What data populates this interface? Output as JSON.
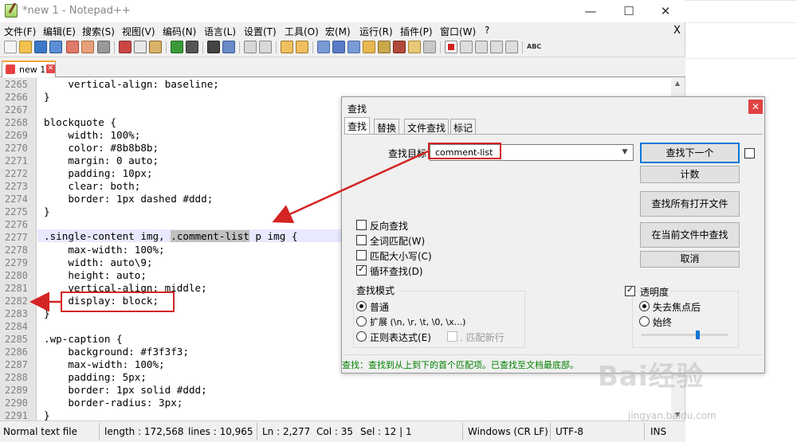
{
  "window": {
    "title": "*new 1 - Notepad++",
    "minimize": "—",
    "maximize": "☐",
    "close": "✕"
  },
  "menu": {
    "items": [
      "文件(F)",
      "编辑(E)",
      "搜索(S)",
      "视图(V)",
      "编码(N)",
      "语言(L)",
      "设置(T)",
      "工具(O)",
      "宏(M)",
      "运行(R)",
      "插件(P)",
      "窗口(W)",
      "?"
    ],
    "close_doc": "X"
  },
  "toolbar": {
    "spell_label": "ABC"
  },
  "tab": {
    "label": "new 1",
    "close": "✕"
  },
  "editor": {
    "line_numbers": [
      "2265",
      "2266",
      "2267",
      "2268",
      "2269",
      "2270",
      "2271",
      "2272",
      "2273",
      "2274",
      "2275",
      "2276",
      "2277",
      "2278",
      "2279",
      "2280",
      "2281",
      "2282",
      "2283",
      "2284",
      "2285",
      "2286",
      "2287",
      "2288",
      "2289",
      "2290",
      "2291"
    ],
    "lines": [
      "    vertical-align: baseline;",
      "}",
      "",
      "blockquote {",
      "    width: 100%;",
      "    color: #8b8b8b;",
      "    margin: 0 auto;",
      "    padding: 10px;",
      "    clear: both;",
      "    border: 1px dashed #ddd;",
      "}",
      "",
      "",
      "    max-width: 100%;",
      "    width: auto\\9;",
      "    height: auto;",
      "    vertical-align: middle;",
      "    display: block;",
      "}",
      "",
      ".wp-caption {",
      "    background: #f3f3f3;",
      "    max-width: 100%;",
      "    padding: 5px;",
      "    border: 1px solid #ddd;",
      "    border-radius: 3px;",
      "}"
    ],
    "current_line_prefix": ".single-content img, ",
    "current_line_match": ".comment-list",
    "current_line_suffix": " p img {"
  },
  "statusbar": {
    "type": "Normal text file",
    "length": "length : 172,568",
    "lines": "lines : 10,965",
    "ln": "Ln : 2,277",
    "col": "Col : 35",
    "sel": "Sel : 12 | 1",
    "eol": "Windows (CR LF)",
    "encoding": "UTF-8",
    "mode": "INS"
  },
  "find_dialog": {
    "title": "查找",
    "close": "✕",
    "tabs": [
      "查找",
      "替换",
      "文件查找",
      "标记"
    ],
    "target_label": "查找目标：",
    "target_value": "comment-list",
    "buttons": {
      "find_next": "查找下一个",
      "count": "计数",
      "find_all_open": "查找所有打开文件",
      "find_in_current": "在当前文件中查找",
      "cancel": "取消"
    },
    "options": {
      "reverse": "反向查找",
      "whole_word": "全词匹配(W)",
      "match_case": "匹配大小写(C)",
      "wrap": "循环查找(D)"
    },
    "search_mode": {
      "title": "查找模式",
      "normal": "普通",
      "extended": "扩展 (\\n, \\r, \\t, \\0, \\x...)",
      "regex": "正则表达式(E)",
      "dot_newline": ". 匹配新行"
    },
    "transparency": {
      "title": "透明度",
      "on_lose_focus": "失去焦点后",
      "always": "始终",
      "level": 0.65
    },
    "status": "查找：查找到从上到下的首个匹配项。已查找至文档最底部。"
  },
  "watermark": {
    "brand": "Bai经验",
    "url": "jingyan.baidu.com"
  },
  "colors": {
    "accent_red": "#d42424",
    "status_green": "#008000",
    "current_line": "#e8e8ff"
  }
}
